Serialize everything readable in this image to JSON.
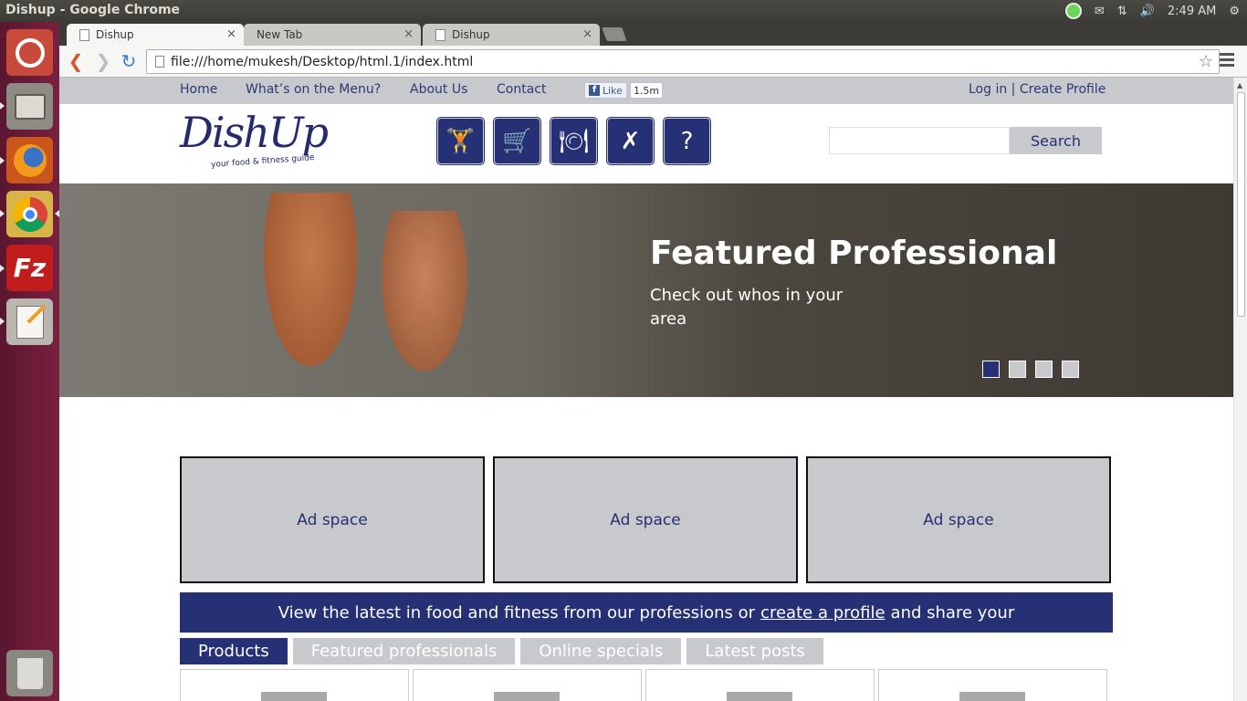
{
  "os_panel": {
    "window_title": "Dishup - Google Chrome",
    "clock": "2:49 AM"
  },
  "browser": {
    "tabs": [
      {
        "label": "Dishup",
        "close": "×"
      },
      {
        "label": "New Tab",
        "close": "×"
      },
      {
        "label": "Dishup",
        "close": "×"
      }
    ],
    "url": "file:///home/mukesh/Desktop/html.1/index.html"
  },
  "site": {
    "nav": {
      "home": "Home",
      "menu": "What’s on the Menu?",
      "about": "About Us",
      "contact": "Contact"
    },
    "facebook": {
      "like": "Like",
      "count": "1.5m"
    },
    "account": {
      "login": "Log in",
      "separator": "|",
      "create": "Create Profile"
    },
    "logo": {
      "word": "DishUp",
      "tagline": "your food & fitness guide"
    },
    "search": {
      "button": "Search",
      "placeholder": ""
    },
    "hero": {
      "title": "Featured Professional",
      "subtitle": "Check out whos in your area",
      "slides": 4,
      "active_slide": 1
    },
    "ads": [
      "Ad space",
      "Ad space",
      "Ad space"
    ],
    "banner": {
      "before": "View the latest in food and fitness from our professions or",
      "link": "create a profile",
      "after": "and share your"
    },
    "content_tabs": [
      "Products",
      "Featured professionals",
      "Online specials",
      "Latest posts"
    ],
    "colors": {
      "brand_navy": "#263075",
      "gray": "#c8c9cd"
    }
  }
}
